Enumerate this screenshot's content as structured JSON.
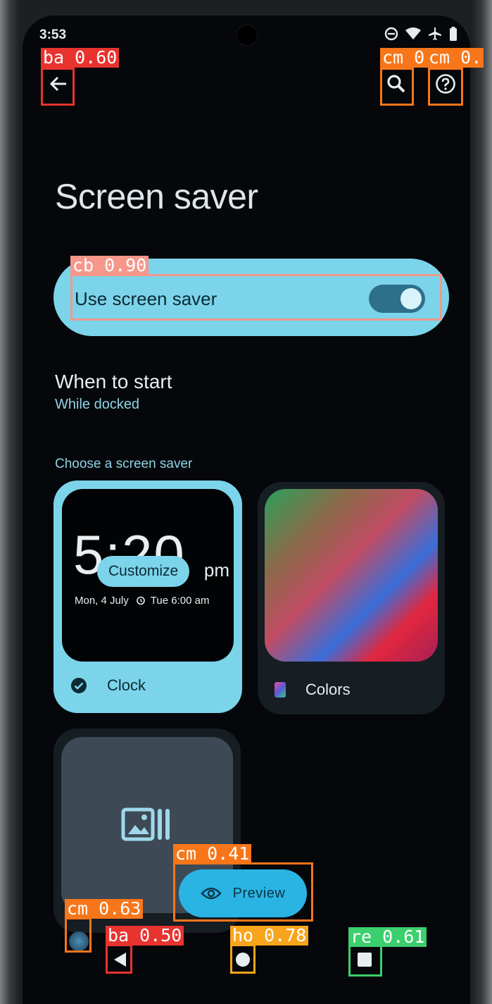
{
  "status_bar": {
    "time": "3:53"
  },
  "page": {
    "title": "Screen saver"
  },
  "toggle": {
    "label": "Use screen saver",
    "checked": true
  },
  "when_to_start": {
    "title": "When to start",
    "value": "While docked"
  },
  "section": {
    "label": "Choose a screen saver"
  },
  "savers": {
    "clock": {
      "time": "5:20",
      "ampm": "pm",
      "date": "Mon, 4 July",
      "alarm": "Tue 6:00 am",
      "chip": "Customize",
      "label": "Clock",
      "selected": true
    },
    "colors": {
      "label": "Colors"
    }
  },
  "preview_button": {
    "label": "Preview"
  },
  "icons": [
    "back-arrow-icon",
    "search-icon",
    "help-icon",
    "eye-icon",
    "check-circle-icon",
    "photo-frame-icon",
    "nav-back-icon",
    "nav-home-icon",
    "nav-recents-icon"
  ],
  "detections": [
    {
      "label": "ba 0.60",
      "color": "#e8332f"
    },
    {
      "label": "cm 0.",
      "color": "#f7761a"
    },
    {
      "label": "cm 0.",
      "color": "#f7761a"
    },
    {
      "label": "cb 0.90",
      "color": "#f5978a"
    },
    {
      "label": "cm 0.41",
      "color": "#f7761a"
    },
    {
      "label": "cm 0.63",
      "color": "#f7761a"
    },
    {
      "label": "ba 0.50",
      "color": "#e8332f"
    },
    {
      "label": "ho 0.78",
      "color": "#f7a51c"
    },
    {
      "label": "re 0.61",
      "color": "#3ccf6e"
    }
  ]
}
